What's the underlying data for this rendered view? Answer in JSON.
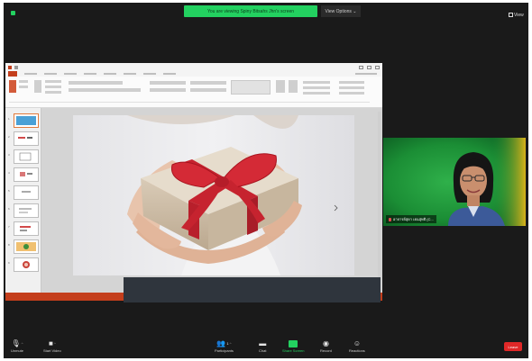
{
  "top_bar": {
    "sharing_banner": "You are viewing Spiny Bitsahs Jhn's screen",
    "view_options_label": "View Options ⌄",
    "view_label": "View"
  },
  "powerpoint": {
    "accent_color": "#c43e1c",
    "thumbnail_numbers": [
      "1",
      "2",
      "3",
      "4",
      "5",
      "6",
      "7",
      "8",
      "9"
    ]
  },
  "participant": {
    "name": "อาจารย์สุดา เธนสุทธิ (C..."
  },
  "toolbar": {
    "unmute_label": "Unmute",
    "start_video_label": "Start Video",
    "participants_label": "Participants",
    "participants_count": "1",
    "chat_label": "Chat",
    "share_screen_label": "Share Screen",
    "record_label": "Record",
    "reactions_label": "Reactions",
    "leave_label": "Leave",
    "share_color": "#23d160",
    "leave_color": "#e02828"
  }
}
